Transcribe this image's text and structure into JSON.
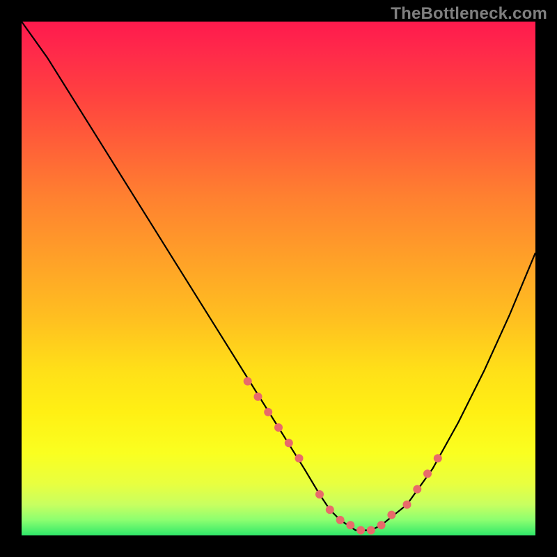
{
  "watermark": "TheBottleneck.com",
  "chart_data": {
    "type": "line",
    "title": "",
    "xlabel": "",
    "ylabel": "",
    "xlim": [
      0,
      100
    ],
    "ylim": [
      0,
      100
    ],
    "series": [
      {
        "name": "bottleneck-curve",
        "x": [
          0,
          5,
          10,
          15,
          20,
          25,
          30,
          35,
          40,
          45,
          50,
          55,
          58,
          60,
          62,
          65,
          68,
          70,
          75,
          80,
          85,
          90,
          95,
          100
        ],
        "y": [
          100,
          93,
          85,
          77,
          69,
          61,
          53,
          45,
          37,
          29,
          21,
          13,
          8,
          5,
          3,
          1,
          1,
          2,
          6,
          13,
          22,
          32,
          43,
          55
        ]
      }
    ],
    "markers": {
      "name": "highlight-dots",
      "color": "#e86a6a",
      "x": [
        44,
        46,
        48,
        50,
        52,
        54,
        58,
        60,
        62,
        64,
        66,
        68,
        70,
        72,
        75,
        77,
        79,
        81
      ],
      "y": [
        30,
        27,
        24,
        21,
        18,
        15,
        8,
        5,
        3,
        2,
        1,
        1,
        2,
        4,
        6,
        9,
        12,
        15
      ]
    },
    "gradient_stops": [
      {
        "pos": 0.0,
        "color": "#ff1a4d"
      },
      {
        "pos": 0.5,
        "color": "#ffd020"
      },
      {
        "pos": 0.85,
        "color": "#f4ff30"
      },
      {
        "pos": 1.0,
        "color": "#30e86a"
      }
    ]
  }
}
